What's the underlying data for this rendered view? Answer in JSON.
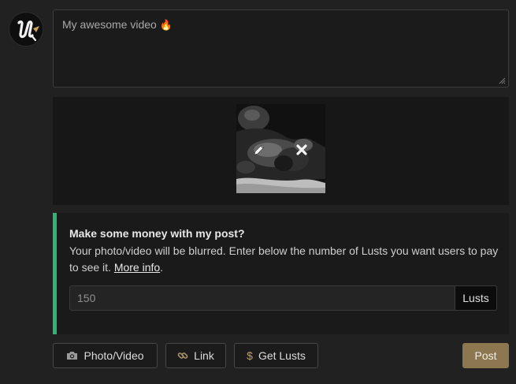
{
  "composer": {
    "value": "My awesome video",
    "emoji": "🔥"
  },
  "monetize": {
    "heading": "Make some money with my post?",
    "description": "Your photo/video will be blurred. Enter below the number of Lusts you want users to pay to see it.",
    "more_info_link": "More info",
    "trailing_period": ".",
    "price_value": "150",
    "price_unit": "Lusts",
    "accent_color": "#2bb673"
  },
  "toolbar": {
    "photo_video_label": "Photo/Video",
    "link_label": "Link",
    "get_lusts_label": "Get Lusts",
    "get_lusts_symbol": "$",
    "post_label": "Post",
    "post_color": "#8c7750"
  },
  "icons": {
    "avatar": "brand-logo-u",
    "photo": "camera-icon",
    "link": "chain-link-icon",
    "edit": "pencil-icon",
    "remove": "close-icon"
  }
}
